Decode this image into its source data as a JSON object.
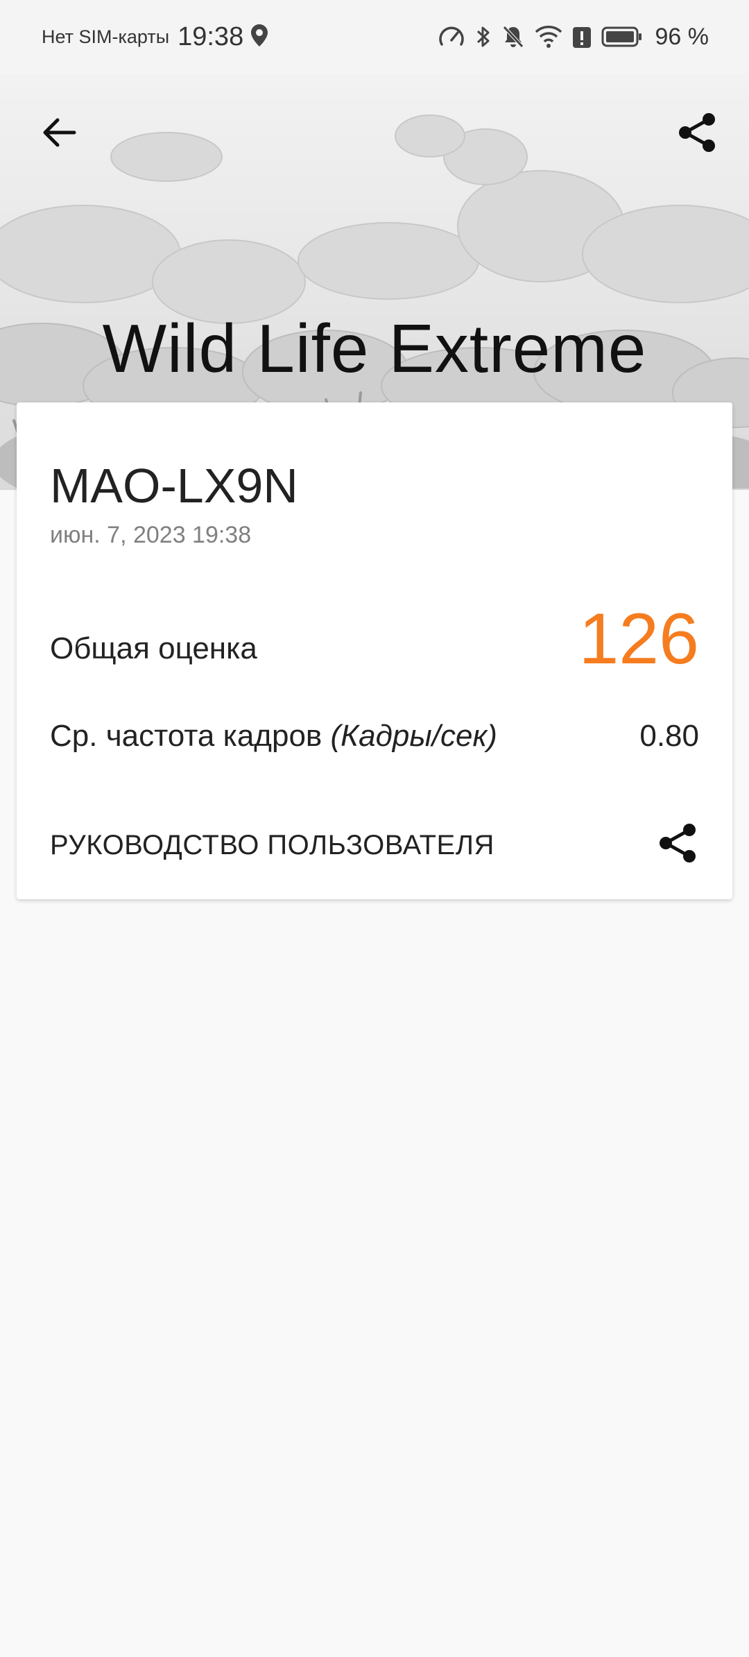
{
  "status_bar": {
    "carrier": "Нет SIM-карты",
    "time": "19:38",
    "battery_percent": "96 %"
  },
  "header": {
    "title": "Wild Life Extreme",
    "back_icon": "arrow-left-icon",
    "share_icon": "share-icon"
  },
  "result": {
    "device_name": "MAO-LX9N",
    "date": "июн. 7, 2023 19:38",
    "overall_score_label": "Общая оценка",
    "overall_score_value": "126",
    "fps_label": "Ср. частота кадров",
    "fps_unit": "(Кадры/сек)",
    "fps_value": "0.80",
    "user_guide_label": "РУКОВОДСТВО ПОЛЬЗОВАТЕЛЯ"
  },
  "colors": {
    "accent_score": "#f57c1f",
    "background": "#f9f9f9",
    "card": "#ffffff"
  }
}
